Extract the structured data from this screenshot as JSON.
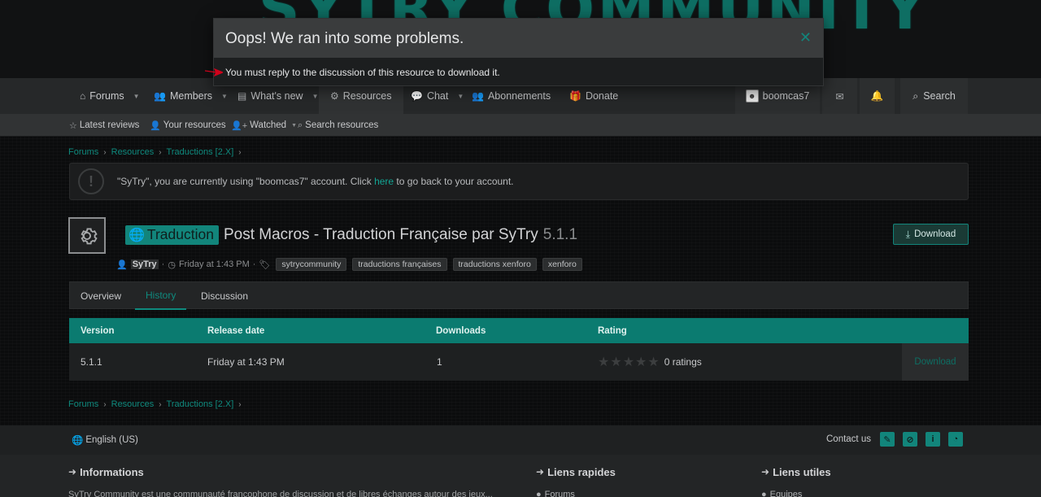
{
  "banner": {
    "logo_text": "SYTRY COMMUNITY"
  },
  "nav": {
    "items": [
      {
        "label": "Forums",
        "icon": "home-icon",
        "caret": true
      },
      {
        "label": "Members",
        "icon": "users-icon",
        "caret": true
      },
      {
        "label": "What's new",
        "icon": "newspaper-icon",
        "caret": true
      },
      {
        "label": "Resources",
        "icon": "cog-icon",
        "caret": false,
        "active": true
      },
      {
        "label": "Chat",
        "icon": "chat-icon",
        "caret": true
      },
      {
        "label": "Abonnements",
        "icon": "users-icon",
        "caret": false
      },
      {
        "label": "Donate",
        "icon": "gift-icon",
        "caret": false
      }
    ],
    "username": "boomcas7",
    "search_label": "Search"
  },
  "subnav": {
    "items": [
      {
        "label": "Latest reviews",
        "icon": "star-icon"
      },
      {
        "label": "Your resources",
        "icon": "user-icon"
      },
      {
        "label": "Watched",
        "icon": "user-plus-icon"
      },
      {
        "label": "Search resources",
        "icon": "search-icon"
      }
    ]
  },
  "breadcrumb": [
    "Forums",
    "Resources",
    "Traductions [2.X]"
  ],
  "notice": {
    "text_before": "\"SyTry\", you are currently using \"boomcas7\" account. Click ",
    "link": "here",
    "text_after": " to go back to your account."
  },
  "resource": {
    "prefix": "Traduction",
    "title": "Post Macros - Traduction Française par SyTry",
    "version": "5.1.1",
    "download_label": "Download",
    "author": "SyTry",
    "date": "Friday at 1:43 PM",
    "tags": [
      "sytrycommunity",
      "traductions françaises",
      "traductions xenforo",
      "xenforo"
    ]
  },
  "tabs": [
    "Overview",
    "History",
    "Discussion"
  ],
  "table": {
    "headers": [
      "Version",
      "Release date",
      "Downloads",
      "Rating"
    ],
    "rows": [
      {
        "version": "5.1.1",
        "date": "Friday at 1:43 PM",
        "downloads": "1",
        "rating": 0,
        "ratings_text": "0 ratings",
        "download": "Download"
      }
    ]
  },
  "footer": {
    "language": "English (US)",
    "contact": "Contact us",
    "headings": [
      "Informations",
      "Liens rapides",
      "Liens utiles"
    ],
    "description": "SyTry Community est une communauté francophone de discussion et de libres échanges autour des jeux...",
    "quick_link": "Forums",
    "useful_link": "Equipes"
  },
  "error": {
    "title": "Oops! We ran into some problems.",
    "message": "You must reply to the discussion of this resource to download it.",
    "close": "✕"
  },
  "colors": {
    "accent": "#12857b",
    "header_bg": "#0b7b70"
  }
}
